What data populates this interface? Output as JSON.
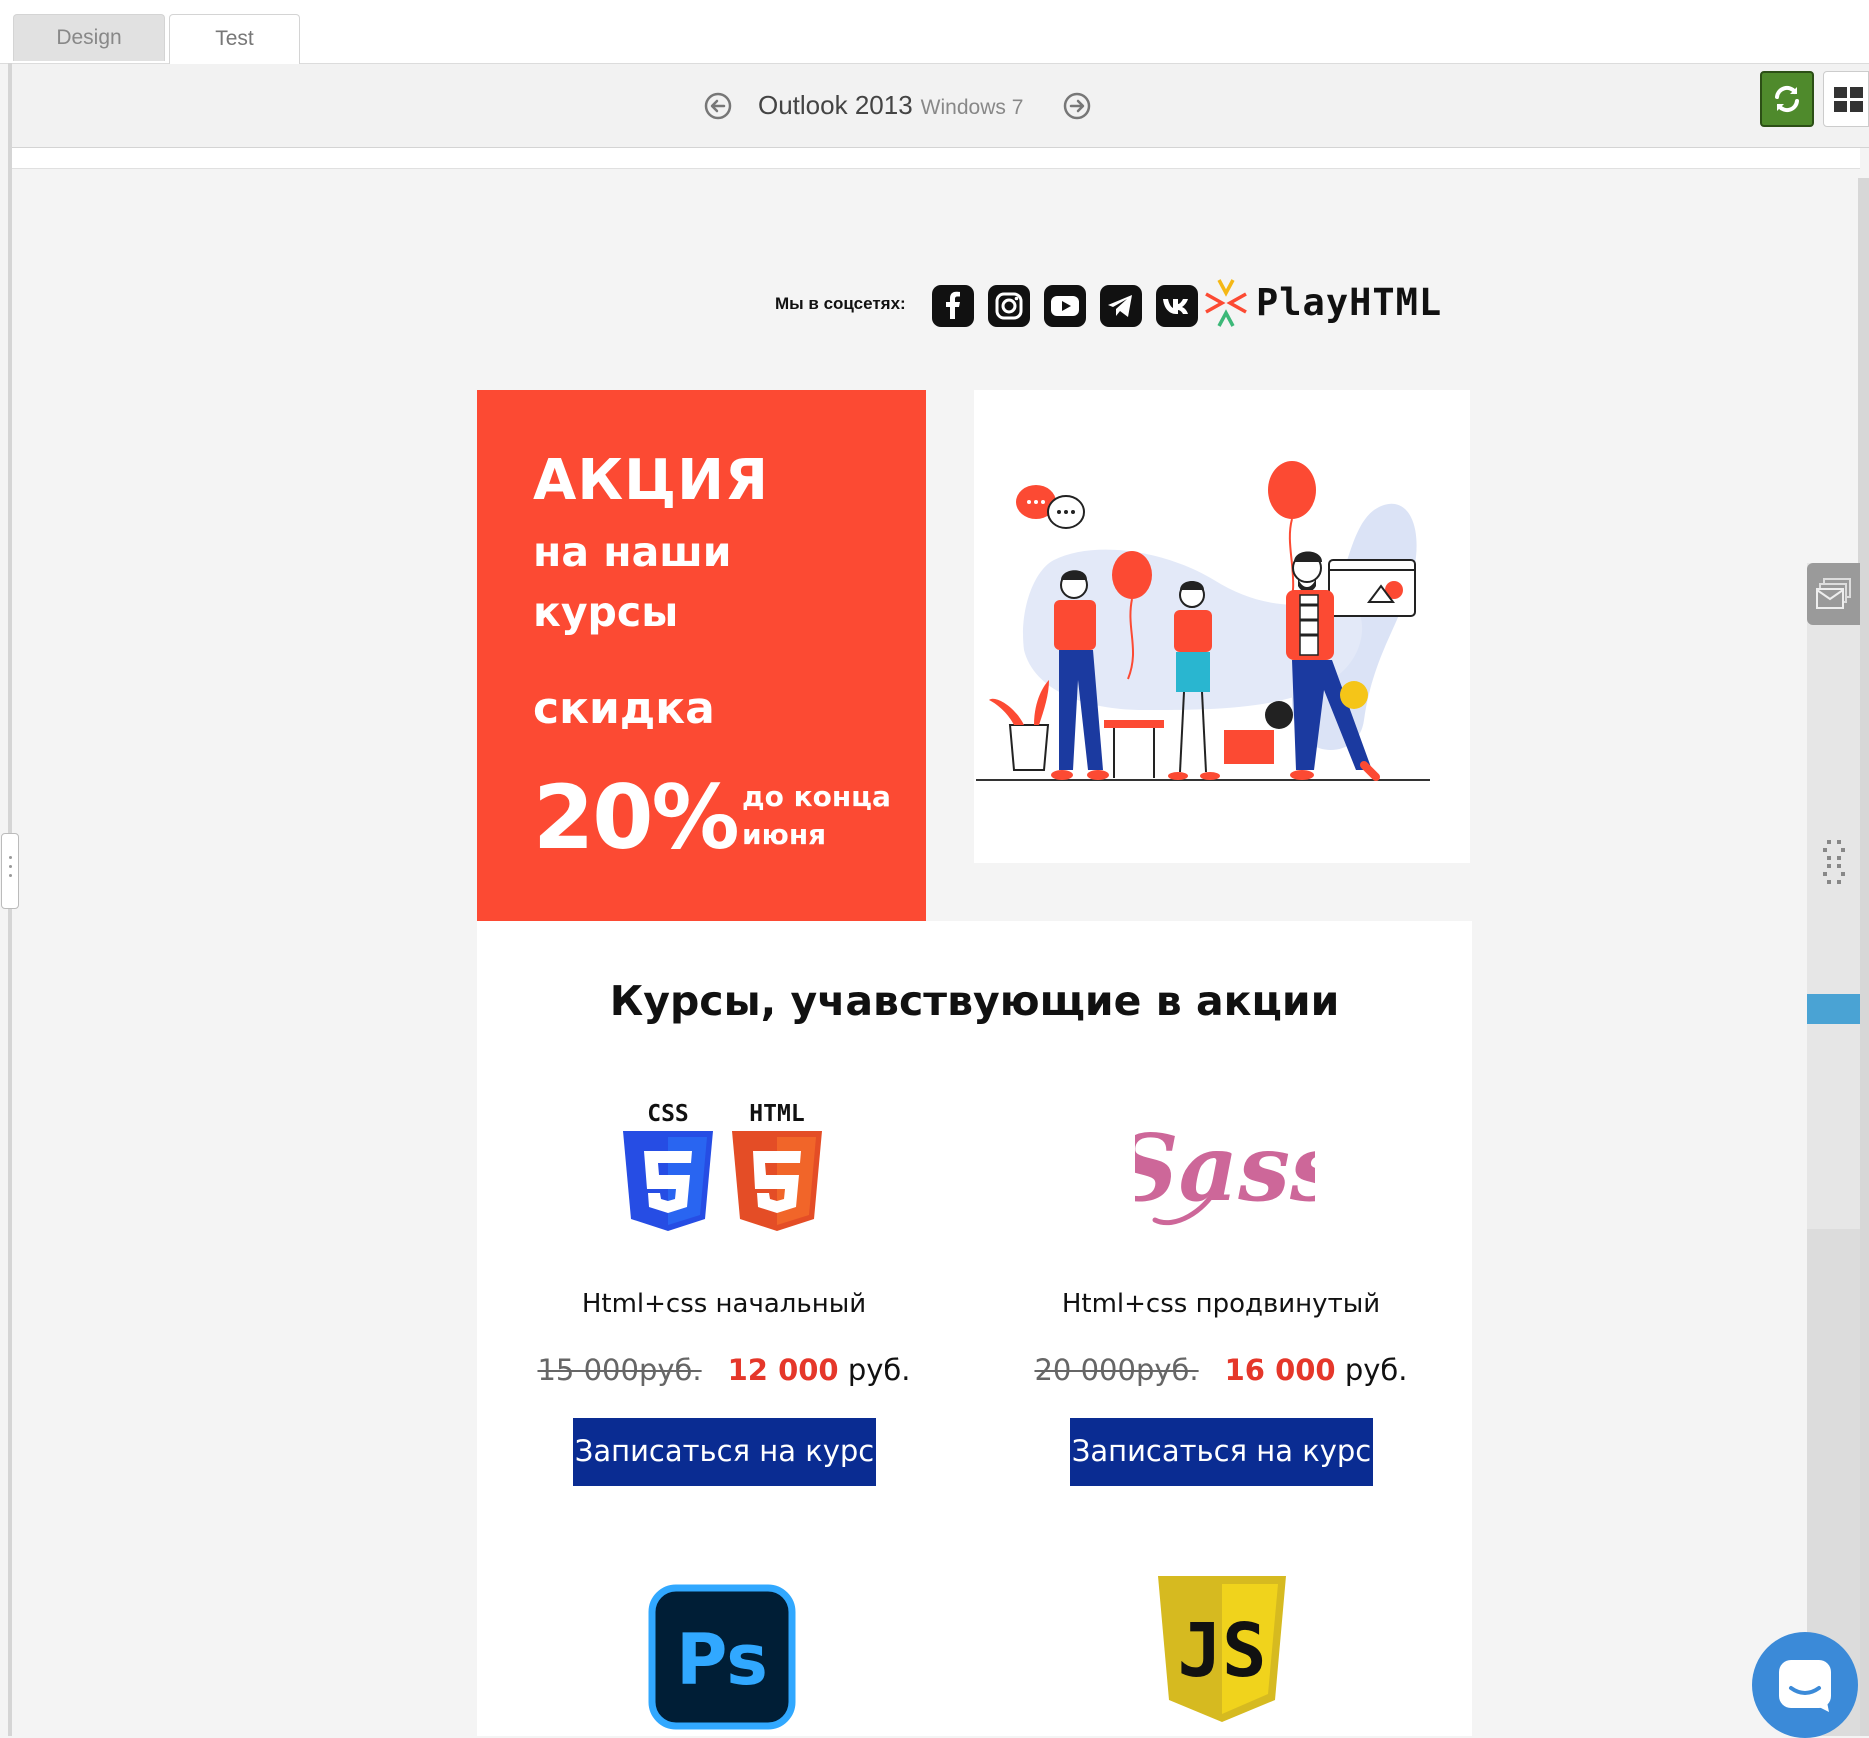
{
  "tabs": {
    "design": "Design",
    "test": "Test"
  },
  "toolbar": {
    "client": "Outlook 2013",
    "os": "Windows 7"
  },
  "email": {
    "social_label": "Мы в соцсетях:",
    "social_icons": [
      "facebook-icon",
      "instagram-icon",
      "youtube-icon",
      "telegram-icon",
      "vk-icon"
    ],
    "brand": "PlayHTML",
    "promo": {
      "title": "АКЦИЯ",
      "line1": "на наши",
      "line2": "курсы",
      "discount_label": "скидка",
      "percent": "20%",
      "until1": "до конца",
      "until2": "июня"
    },
    "courses_title": "Курсы, учавствующие в акции",
    "courses": [
      {
        "logo": "css-html-logo",
        "css_tag": "CSS",
        "html_tag": "HTML",
        "name": "Html+css начальный",
        "old_price": "15 000руб.",
        "new_price": "12 000",
        "currency": "руб.",
        "button": "Записаться на курс"
      },
      {
        "logo": "sass-logo",
        "logo_text": "Sass",
        "name": "Html+css продвинутый",
        "old_price": "20 000руб.",
        "new_price": "16 000",
        "currency": "руб.",
        "button": "Записаться на курс"
      },
      {
        "logo": "photoshop-logo",
        "logo_text": "Ps"
      },
      {
        "logo": "javascript-logo",
        "logo_text": "JS"
      }
    ]
  },
  "colors": {
    "promo_bg": "#fc4a33",
    "button_bg": "#0a2c92",
    "price_new": "#e5372a",
    "refresh_green": "#4f8a2c",
    "chat_blue": "#3b8ad8"
  }
}
